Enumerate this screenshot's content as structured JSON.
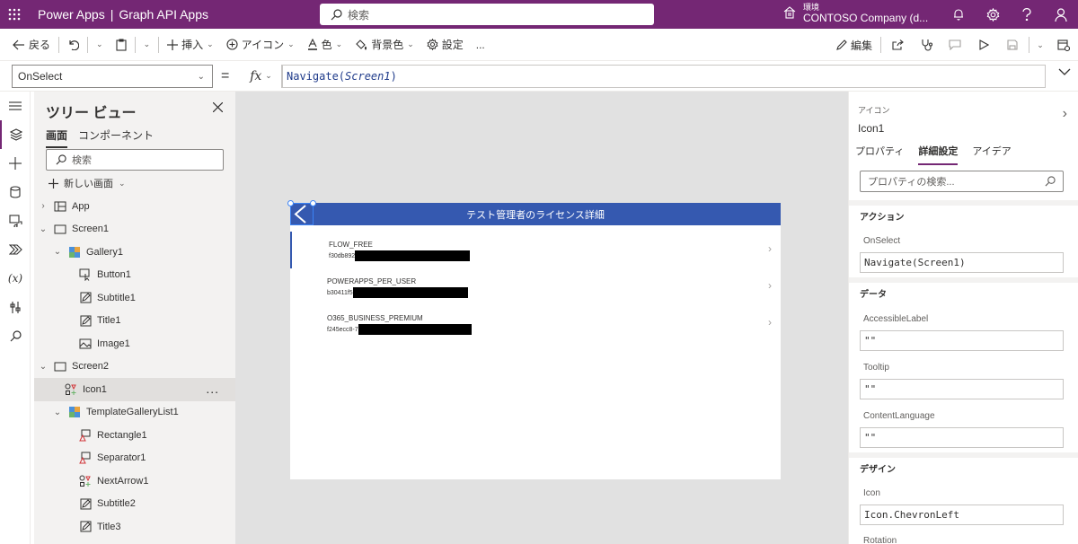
{
  "topbar": {
    "app_name": "Power Apps",
    "separator": "|",
    "app_title": "Graph API Apps",
    "search_placeholder": "検索",
    "env_label": "環境",
    "env_name": "CONTOSO Company (d...",
    "accent": "#742774"
  },
  "commands": {
    "back": "戻る",
    "insert": "挿入",
    "icons": "アイコン",
    "color": "色",
    "background": "背景色",
    "settings": "設定",
    "more": "...",
    "edit": "編集"
  },
  "formula_bar": {
    "property": "OnSelect",
    "equals": "=",
    "fx": "fx",
    "func": "Navigate",
    "arg": "Screen1"
  },
  "tree": {
    "title": "ツリー ビュー",
    "tabs": [
      "画面",
      "コンポーネント"
    ],
    "search_placeholder": "検索",
    "new_screen": "新しい画面",
    "nodes": [
      {
        "label": "App",
        "indent": 0
      },
      {
        "label": "Screen1",
        "indent": 0
      },
      {
        "label": "Gallery1",
        "indent": 1
      },
      {
        "label": "Button1",
        "indent": 2
      },
      {
        "label": "Subtitle1",
        "indent": 2
      },
      {
        "label": "Title1",
        "indent": 2
      },
      {
        "label": "Image1",
        "indent": 2
      },
      {
        "label": "Screen2",
        "indent": 0
      },
      {
        "label": "Icon1",
        "indent": 1
      },
      {
        "label": "TemplateGalleryList1",
        "indent": 1
      },
      {
        "label": "Rectangle1",
        "indent": 2
      },
      {
        "label": "Separator1",
        "indent": 2
      },
      {
        "label": "NextArrow1",
        "indent": 2
      },
      {
        "label": "Subtitle2",
        "indent": 2
      },
      {
        "label": "Title3",
        "indent": 2
      }
    ],
    "selected_more": "..."
  },
  "canvas": {
    "header_title": "テスト管理者のライセンス詳細",
    "header_color": "#3559b0",
    "licenses": [
      {
        "name": "FLOW_FREE",
        "id_prefix": "f30db892"
      },
      {
        "name": "POWERAPPS_PER_USER",
        "id_prefix": "b30411f5"
      },
      {
        "name": "O365_BUSINESS_PREMIUM",
        "id_prefix": "f245ecc8-7"
      }
    ]
  },
  "properties": {
    "control_type": "アイコン",
    "control_name": "Icon1",
    "tabs": [
      "プロパティ",
      "詳細設定",
      "アイデア"
    ],
    "search_placeholder": "プロパティの検索...",
    "sections": {
      "action": "アクション",
      "data": "データ",
      "design": "デザイン"
    },
    "fields": {
      "onselect_label": "OnSelect",
      "onselect_value": "Navigate(Screen1)",
      "accessible_label": "AccessibleLabel",
      "accessible_value": "\"\"",
      "tooltip_label": "Tooltip",
      "tooltip_value": "\"\"",
      "contentlang_label": "ContentLanguage",
      "contentlang_value": "\"\"",
      "icon_label": "Icon",
      "icon_value": "Icon.ChevronLeft",
      "rotation_label": "Rotation"
    }
  }
}
